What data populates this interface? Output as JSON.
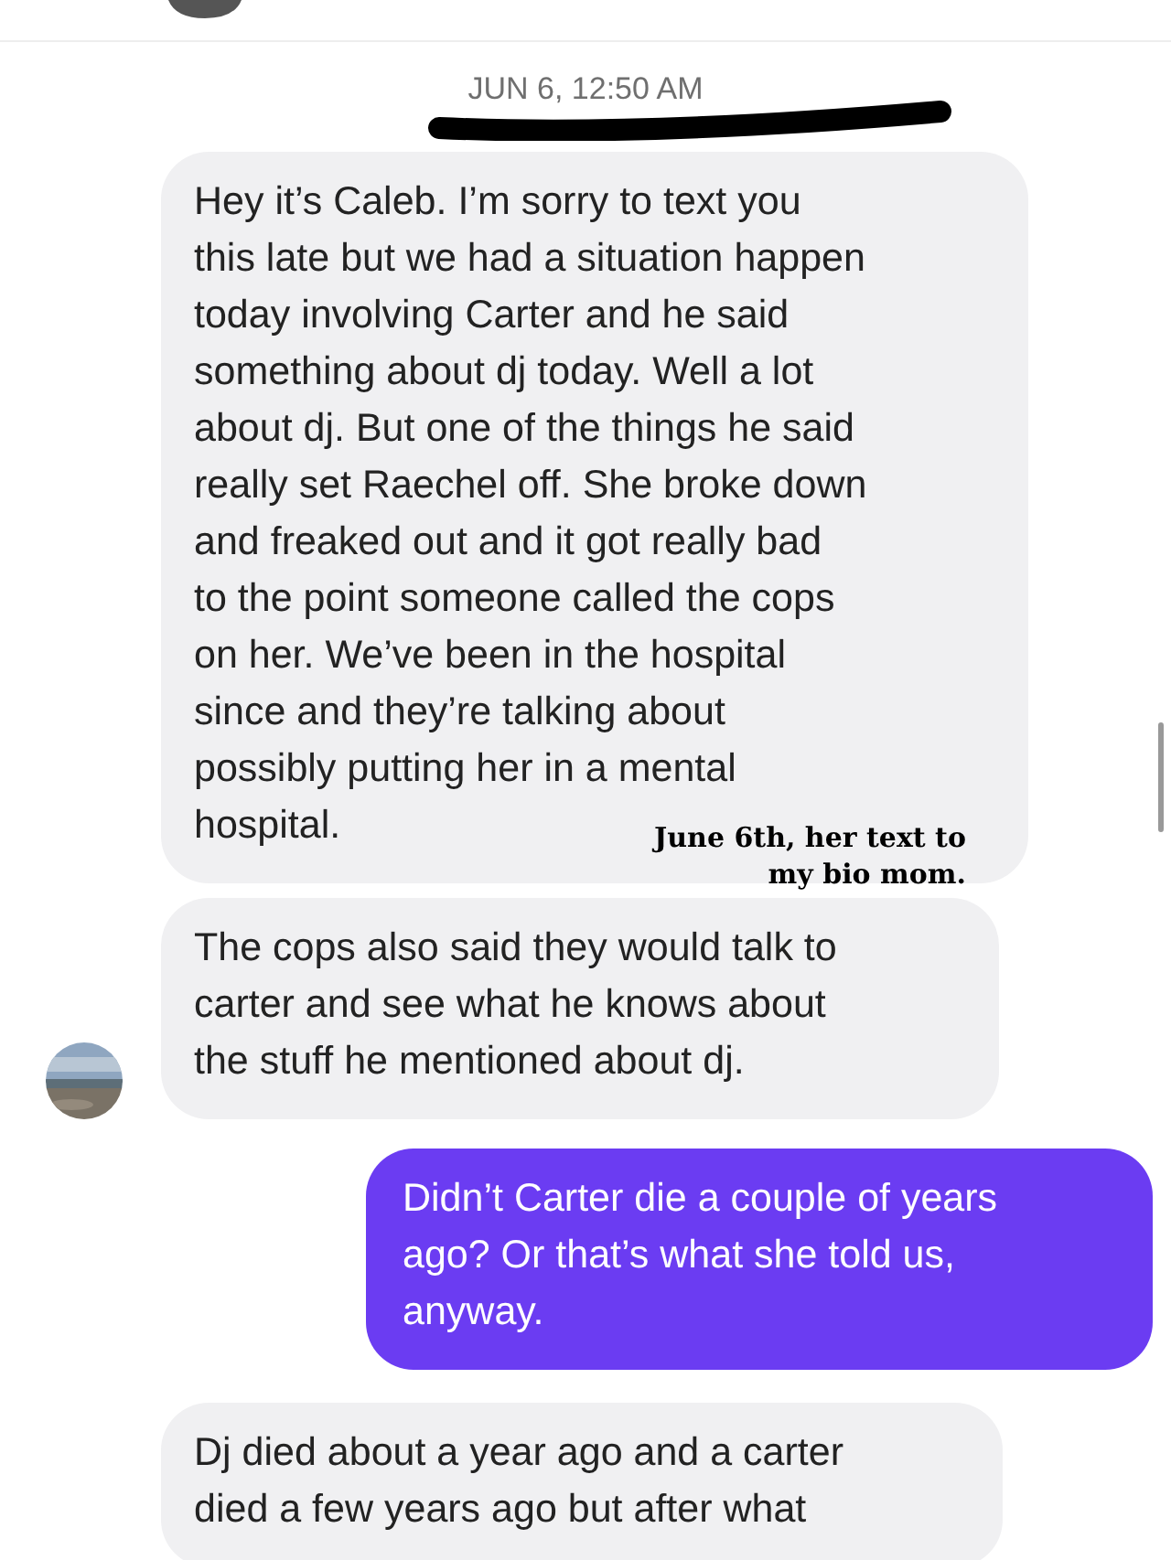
{
  "date_divider": "JUN 6, 12:50 AM",
  "messages": [
    {
      "kind": "incoming",
      "text": "Hey it’s Caleb. I’m sorry to text you\nthis late but we had a situation happen\ntoday involving Carter and he said\nsomething about dj today. Well a lot\nabout dj. But one of the things he said\nreally set Raechel off. She broke down\nand freaked out and it got really bad\nto the point someone called the cops\non her. We’ve been in the hospital\nsince and they’re talking about\npossibly putting her in a mental\nhospital."
    },
    {
      "kind": "incoming",
      "text": "The cops also said they would talk to\ncarter and see what he knows about\nthe stuff he mentioned about dj."
    },
    {
      "kind": "outgoing",
      "text": "Didn’t Carter die a couple of years\nago? Or that’s what she told us,\nanyway."
    },
    {
      "kind": "incoming",
      "text": "Dj died about a year ago and a carter\ndied a few years ago but after what"
    }
  ],
  "caption": "June 6th, her text to\nmy bio mom."
}
